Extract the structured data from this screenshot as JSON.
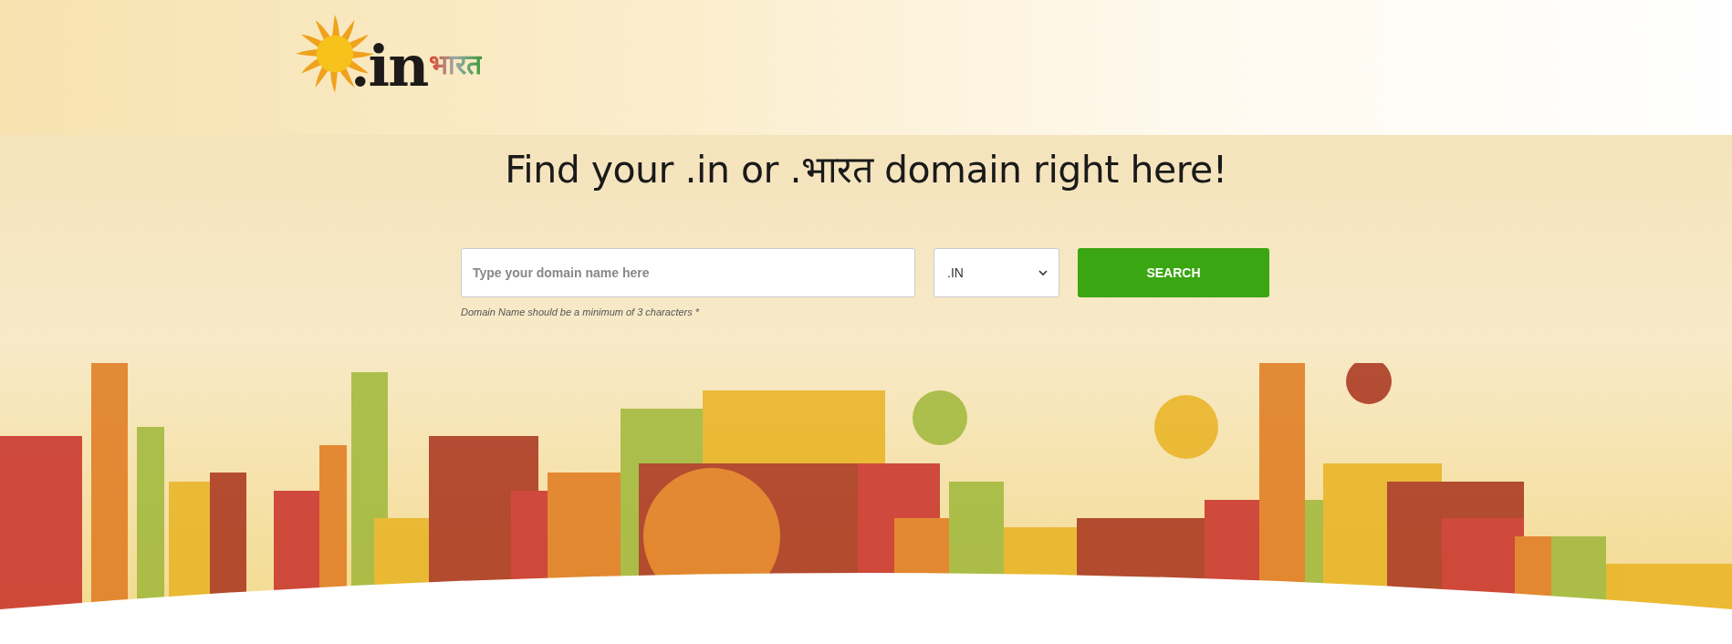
{
  "logo": {
    "primary": ".in",
    "secondary": "भारत"
  },
  "hero": {
    "heading": "Find your .in or .भारत domain right here!",
    "search": {
      "placeholder": "Type your domain name here",
      "extension": ".IN",
      "button": "SEARCH",
      "hint": "Domain Name should be a minimum of 3 characters *"
    }
  }
}
